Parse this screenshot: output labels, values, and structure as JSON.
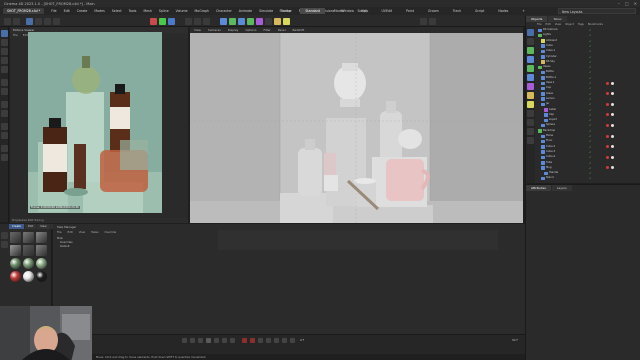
{
  "window": {
    "title": "Cinema 4D 2023.1.0 - [SHOT_FROM28.c4d *] - Main"
  },
  "menubar": {
    "tabs": [
      "SHOT_FROM28.c4d *"
    ],
    "items": [
      "File",
      "Edit",
      "Create",
      "Modes",
      "Select",
      "Tools",
      "Mesh",
      "Spline",
      "Volume",
      "MoGraph",
      "Character",
      "Animate",
      "Simulate",
      "Tracker",
      "Render",
      "Extensions",
      "Window",
      "Help"
    ],
    "layouts": [
      "Startup",
      "Standard",
      "Model",
      "Sculpt",
      "UVEdit",
      "Paint",
      "Groom",
      "Track",
      "Script",
      "Nodes",
      "+"
    ],
    "active_layout": "Standard",
    "file_selector": "New Layouts"
  },
  "render_panel": {
    "title": "Picture Viewer",
    "menus": [
      "File",
      "Edit",
      "View",
      "Compare",
      "Animation",
      "Filter"
    ],
    "info": "Frame: 0  00:00:00  1000x1500  20:36",
    "status": "Progressive Path Tracing"
  },
  "viewport": {
    "menus": [
      "View",
      "Cameras",
      "Display",
      "Options",
      "Filter",
      "Panel",
      "Redshift"
    ]
  },
  "object_manager": {
    "tabs": [
      "Objects",
      "Takes"
    ],
    "active_tab": "Objects",
    "menus": [
      "File",
      "Edit",
      "View",
      "Object",
      "Tags",
      "Bookmarks"
    ],
    "rows": [
      {
        "name": "RS Camera"
      },
      {
        "name": "Lights"
      },
      {
        "name": "Ambient"
      },
      {
        "name": "Cube"
      },
      {
        "name": "Cube.1"
      },
      {
        "name": "Cylinder"
      },
      {
        "name": "RS Sky"
      },
      {
        "name": "Vases"
      },
      {
        "name": "Bottle"
      },
      {
        "name": "Bottle.1"
      },
      {
        "name": "Vase.1"
      },
      {
        "name": "Cup"
      },
      {
        "name": "Glass"
      },
      {
        "name": "Lemon"
      },
      {
        "name": "Jar"
      },
      {
        "name": "Label"
      },
      {
        "name": "Cap"
      },
      {
        "name": "Liquid"
      },
      {
        "name": "Sphere"
      },
      {
        "name": "Backdrop"
      },
      {
        "name": "Plane"
      },
      {
        "name": "Floor"
      },
      {
        "name": "Cube.2"
      },
      {
        "name": "Cube.3"
      },
      {
        "name": "Cube.4"
      },
      {
        "name": "Tube"
      },
      {
        "name": "Mug"
      },
      {
        "name": "Handle"
      },
      {
        "name": "Stand"
      }
    ]
  },
  "attribute_manager": {
    "tabs": [
      "Attributes",
      "Layers"
    ],
    "active_tab": "Attributes"
  },
  "material_manager": {
    "tabs": [
      "Create",
      "Edit",
      "View",
      "Select"
    ],
    "active_tab": "Create",
    "swatch_colors": [
      "#6a6a6a",
      "#7a7a7a",
      "#8a8a8a",
      "#9a9a9a",
      "#5c5c5c",
      "#828282",
      "#6e8e6a",
      "#7e9e7a",
      "#90b08a",
      "#c23a3a",
      "#e8e8e8",
      "#1e1e1e"
    ]
  },
  "takes": {
    "title": "Take Manager",
    "menus": [
      "File",
      "Edit",
      "View",
      "Takes",
      "Override"
    ],
    "items": [
      "Main",
      "Overrides",
      "Default"
    ]
  },
  "timeline": {
    "current_frame": "0 F",
    "end_frame": "90 F"
  },
  "statusbar": {
    "text": "Move: Click and drag to move elements. Hold down SHIFT to quantize movement."
  },
  "colors": {
    "accent": "#3d5a8a",
    "viewport_bg": "#b7b7b7",
    "render_bg": "#7fa89a"
  }
}
